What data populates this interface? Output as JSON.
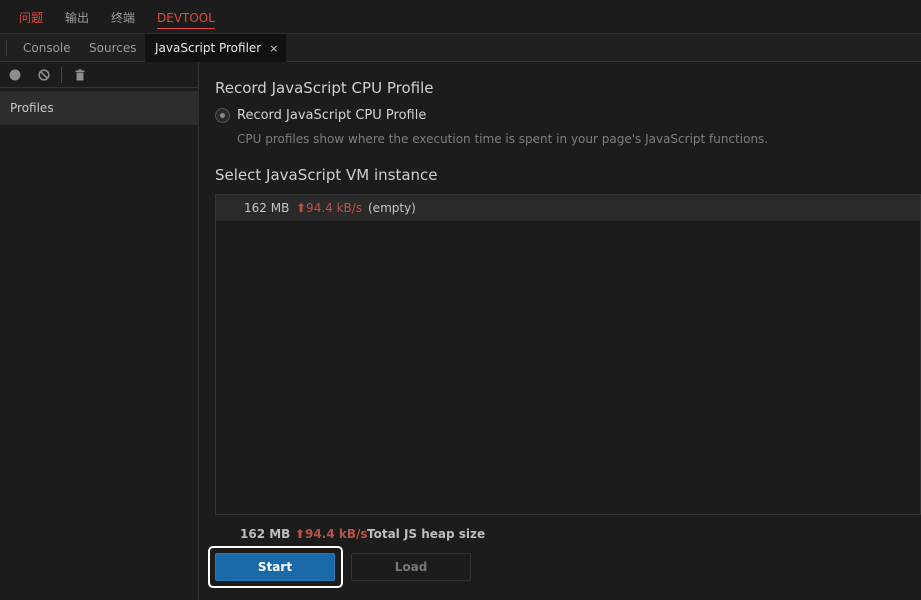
{
  "panel_tabs": [
    {
      "label": "问题"
    },
    {
      "label": "输出"
    },
    {
      "label": "终端"
    },
    {
      "label": "DEVTOOL"
    }
  ],
  "devtools_tabs": [
    {
      "label": "Console"
    },
    {
      "label": "Sources"
    },
    {
      "label": "JavaScript Profiler",
      "close": "×"
    }
  ],
  "sidebar": {
    "toolbar_icons": [
      "record-icon",
      "clear-icon",
      "trash-icon"
    ],
    "profiles_label": "Profiles"
  },
  "main": {
    "record_heading": "Record JavaScript CPU Profile",
    "radio_label": "Record JavaScript CPU Profile",
    "radio_description": "CPU profiles show where the execution time is spent in your page's JavaScript functions.",
    "vm_heading": "Select JavaScript VM instance",
    "vm_instances": [
      {
        "size": "162 MB",
        "rate": "⬆94.4 kB/s",
        "name": "(empty)"
      }
    ],
    "summary": {
      "size": "162 MB",
      "rate": "⬆94.4 kB/s",
      "label": "Total JS heap size"
    },
    "start_button": "Start",
    "load_button": "Load"
  },
  "colors": {
    "accent_red": "#e0493c",
    "rate_red": "#c0504a",
    "start_blue": "#1a69a8"
  }
}
